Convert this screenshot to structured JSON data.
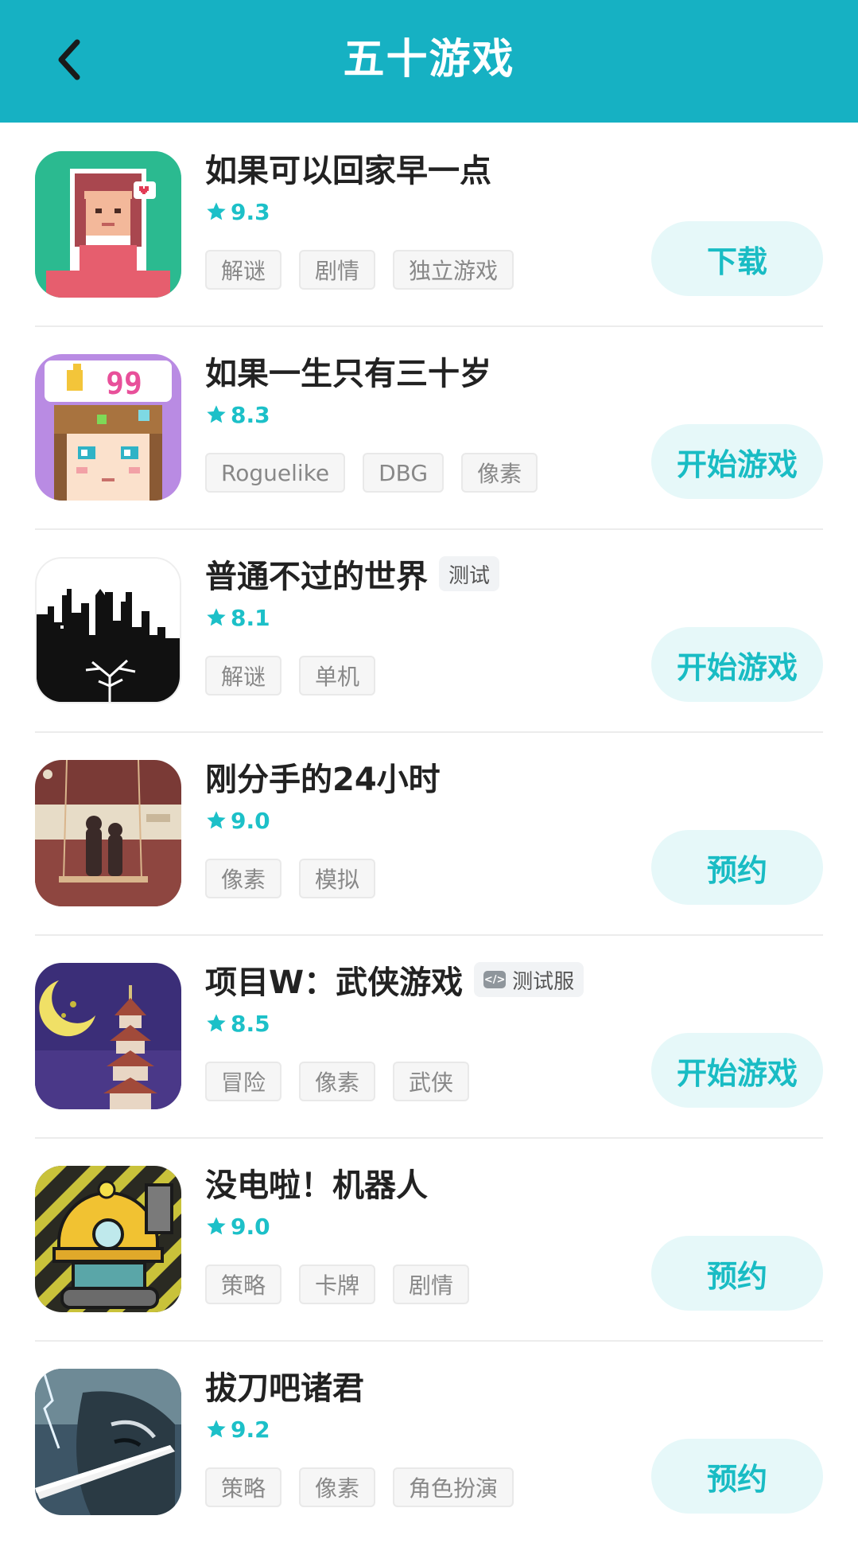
{
  "header": {
    "title": "五十游戏",
    "back_icon": "chevron-left-icon",
    "background": "#16b1c3"
  },
  "accent_color": "#1cc0c8",
  "games": [
    {
      "title": "如果可以回家早一点",
      "badge": "",
      "rating": "9.3",
      "tags": [
        "解谜",
        "剧情",
        "独立游戏"
      ],
      "action": "下载",
      "icon": "pixel-girl-heart-icon"
    },
    {
      "title": "如果一生只有三十岁",
      "badge": "",
      "rating": "8.3",
      "tags": [
        "Roguelike",
        "DBG",
        "像素"
      ],
      "action": "开始游戏",
      "icon": "pixel-girl-thumbs-up-99-icon"
    },
    {
      "title": "普通不过的世界",
      "badge": "测试",
      "rating": "8.1",
      "tags": [
        "解谜",
        "单机"
      ],
      "action": "开始游戏",
      "icon": "city-silhouette-tree-icon"
    },
    {
      "title": "刚分手的24小时",
      "badge": "",
      "rating": "9.0",
      "tags": [
        "像素",
        "模拟"
      ],
      "action": "预约",
      "icon": "couple-swing-icon"
    },
    {
      "title": "项目W：武侠游戏",
      "badge": "测试服",
      "rating": "8.5",
      "tags": [
        "冒险",
        "像素",
        "武侠"
      ],
      "action": "开始游戏",
      "icon": "pagoda-moon-icon"
    },
    {
      "title": "没电啦！机器人",
      "badge": "",
      "rating": "9.0",
      "tags": [
        "策略",
        "卡牌",
        "剧情"
      ],
      "action": "预约",
      "icon": "robot-miner-icon"
    },
    {
      "title": "拔刀吧诸君",
      "badge": "",
      "rating": "9.2",
      "tags": [
        "策略",
        "像素",
        "角色扮演"
      ],
      "action": "预约",
      "icon": "swordsman-lightning-icon"
    }
  ]
}
